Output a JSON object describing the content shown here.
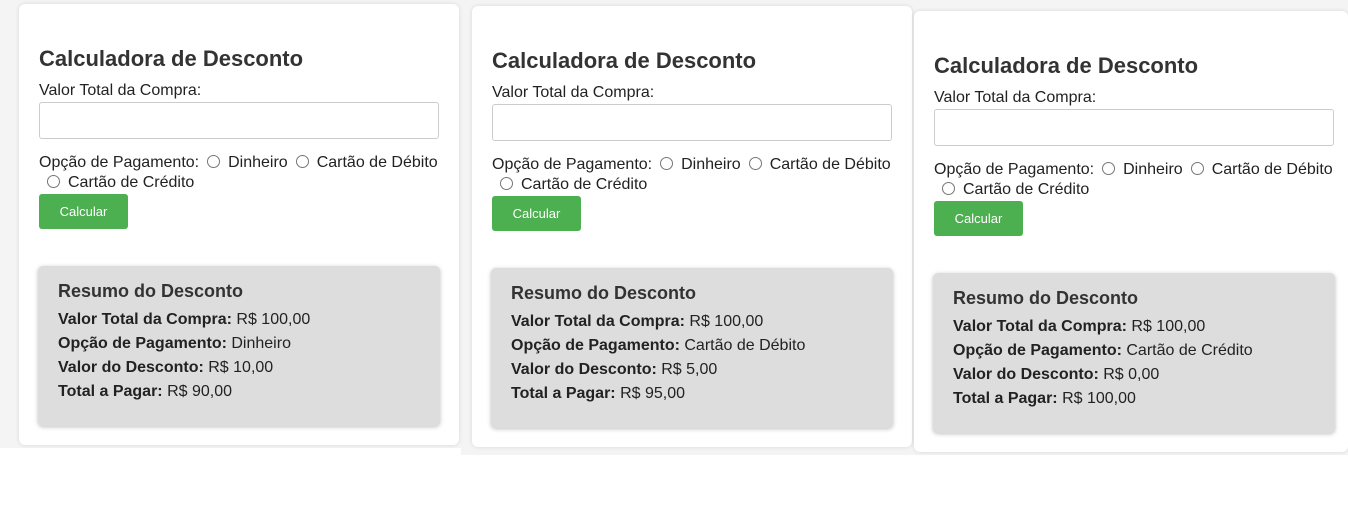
{
  "cards": [
    {
      "title": "Calculadora de Desconto",
      "total_label": "Valor Total da Compra:",
      "total_value": "",
      "payment_label": "Opção de Pagamento:",
      "options": [
        "Dinheiro",
        "Cartão de Débito",
        "Cartão de Crédito"
      ],
      "button_label": "Calcular",
      "summary": {
        "title": "Resumo do Desconto",
        "lines": [
          {
            "label": "Valor Total da Compra:",
            "value": "R$ 100,00"
          },
          {
            "label": "Opção de Pagamento:",
            "value": "Dinheiro"
          },
          {
            "label": "Valor do Desconto:",
            "value": "R$ 10,00"
          },
          {
            "label": "Total a Pagar:",
            "value": "R$ 90,00"
          }
        ]
      }
    },
    {
      "title": "Calculadora de Desconto",
      "total_label": "Valor Total da Compra:",
      "total_value": "",
      "payment_label": "Opção de Pagamento:",
      "options": [
        "Dinheiro",
        "Cartão de Débito",
        "Cartão de Crédito"
      ],
      "button_label": "Calcular",
      "summary": {
        "title": "Resumo do Desconto",
        "lines": [
          {
            "label": "Valor Total da Compra:",
            "value": "R$ 100,00"
          },
          {
            "label": "Opção de Pagamento:",
            "value": "Cartão de Débito"
          },
          {
            "label": "Valor do Desconto:",
            "value": "R$ 5,00"
          },
          {
            "label": "Total a Pagar:",
            "value": "R$ 95,00"
          }
        ]
      }
    },
    {
      "title": "Calculadora de Desconto",
      "total_label": "Valor Total da Compra:",
      "total_value": "",
      "payment_label": "Opção de Pagamento:",
      "options": [
        "Dinheiro",
        "Cartão de Débito",
        "Cartão de Crédito"
      ],
      "button_label": "Calcular",
      "summary": {
        "title": "Resumo do Desconto",
        "lines": [
          {
            "label": "Valor Total da Compra:",
            "value": "R$ 100,00"
          },
          {
            "label": "Opção de Pagamento:",
            "value": "Cartão de Crédito"
          },
          {
            "label": "Valor do Desconto:",
            "value": "R$ 0,00"
          },
          {
            "label": "Total a Pagar:",
            "value": "R$ 100,00"
          }
        ]
      }
    }
  ],
  "colors": {
    "button": "#4caf50",
    "summary_bg": "#dddddd",
    "page_bg": "#f4f4f4"
  }
}
